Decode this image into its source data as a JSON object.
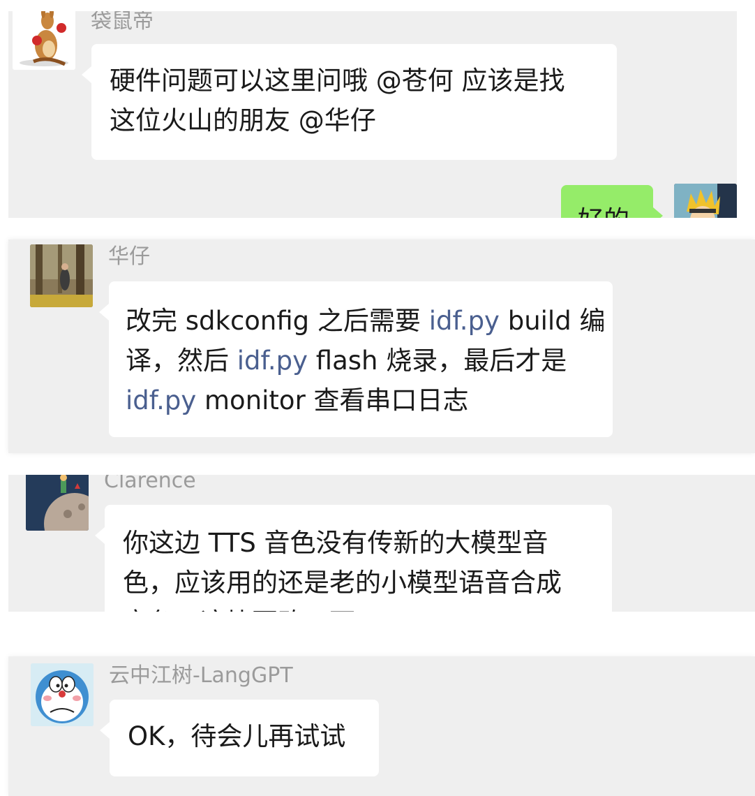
{
  "messages": {
    "m1": {
      "sender": "袋鼠帝",
      "line1": "硬件问题可以这里问哦 @苍何  应该是找",
      "line2": "这位火山的朋友 @华仔"
    },
    "m2": {
      "text": "好的"
    },
    "m3": {
      "sender": "华仔",
      "l1a": "改完 sdkconfig 之后需要 ",
      "l1b": "idf.py",
      "l1c": " build 编",
      "l2a": "译，然后 ",
      "l2b": "idf.py",
      "l2c": " flash 烧录，最后才是",
      "l3a": "idf.py",
      "l3b": " monitor 查看串口日志"
    },
    "m4": {
      "sender": "Clarence",
      "line1": "你这边 TTS 音色没有传新的大模型音",
      "line2": "色，应该用的还是老的小模型语音合成",
      "line3": "音色，这块更改一下"
    },
    "m5": {
      "sender": "云中江树-LangGPT",
      "text": "OK，待会儿再试试"
    }
  },
  "colors": {
    "panel": "#efefef",
    "bubble_other": "#ffffff",
    "bubble_self": "#95ec69",
    "link": "#4a5f8f",
    "name": "#9b9b9b"
  }
}
